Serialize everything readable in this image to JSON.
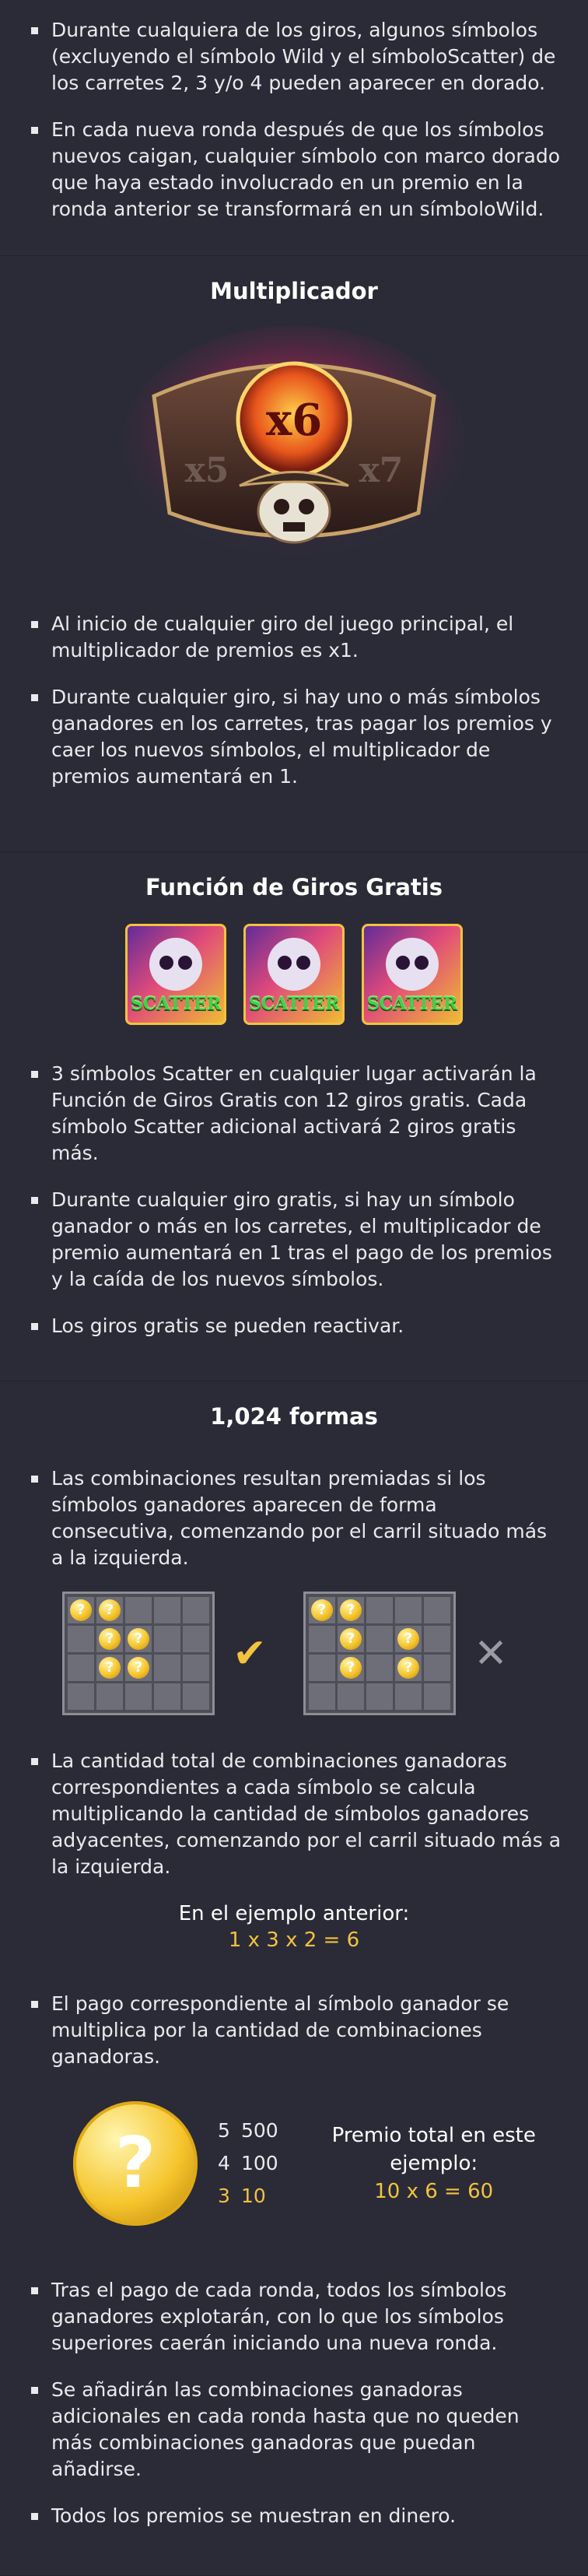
{
  "intro": {
    "bullets": [
      "Durante cualquiera de los giros, algunos símbolos (excluyendo el símbolo Wild y el símboloScatter) de los carretes 2, 3 y/o 4 pueden aparecer en dorado.",
      "En cada nueva ronda después de que los símbolos nuevos caigan, cualquier símbolo con marco dorado que haya estado involucrado en un premio en la ronda anterior se transformará en un símboloWild."
    ]
  },
  "multiplier": {
    "title": "Multiplicador",
    "art": {
      "left": "x5",
      "center": "x6",
      "right": "x7"
    },
    "bullets": [
      "Al inicio de cualquier giro del juego principal, el multiplicador de premios es x1.",
      "Durante cualquier giro, si hay uno o más símbolos ganadores en los carretes, tras pagar los premios y caer los nuevos símbolos, el multiplicador de premios aumentará en 1."
    ]
  },
  "free_spins": {
    "title": "Función de Giros Gratis",
    "scatter_label": "SCATTER",
    "bullets": [
      "3 símbolos Scatter en cualquier lugar activarán la Función de Giros Gratis con 12 giros gratis. Cada símbolo Scatter adicional activará 2 giros gratis más.",
      "Durante cualquier giro gratis, si hay un símbolo ganador o más en los carretes, el multiplicador de premio aumentará en 1 tras el pago de los premios y la caída de los nuevos símbolos.",
      "Los giros gratis se pueden reactivar."
    ]
  },
  "ways": {
    "title": "1,024 formas",
    "bullet_1": "Las combinaciones resultan premiadas si los símbolos ganadores aparecen de forma consecutiva, comenzando por el carril situado más a la izquierda.",
    "coin_glyph": "?",
    "check": "✔",
    "cross": "✕",
    "bullet_2": "La cantidad total de combinaciones ganadoras correspondientes a cada símbolo se calcula multiplicando la cantidad de símbolos ganadores adyacentes, comenzando por el carril situado más a la izquierda.",
    "example_heading": "En el ejemplo anterior:",
    "example_formula": "1 x 3 x 2 = 6",
    "bullet_3": "El pago correspondiente al símbolo ganador se multiplica por la cantidad de combinaciones ganadoras.",
    "paytable": [
      {
        "count": "5",
        "value": "500",
        "highlight": false
      },
      {
        "count": "4",
        "value": "100",
        "highlight": false
      },
      {
        "count": "3",
        "value": "10",
        "highlight": true
      }
    ],
    "total_label": "Premio total en este ejemplo:",
    "total_formula": "10 x 6 = 60",
    "bullets_end": [
      "Tras el pago de cada ronda, todos los símbolos ganadores explotarán, con lo que los símbolos superiores caerán iniciando una nueva ronda.",
      "Se añadirán las combinaciones ganadoras adicionales en cada ronda hasta que no queden más combinaciones ganadoras que puedan añadirse.",
      "Todos los premios se muestran en dinero."
    ]
  }
}
